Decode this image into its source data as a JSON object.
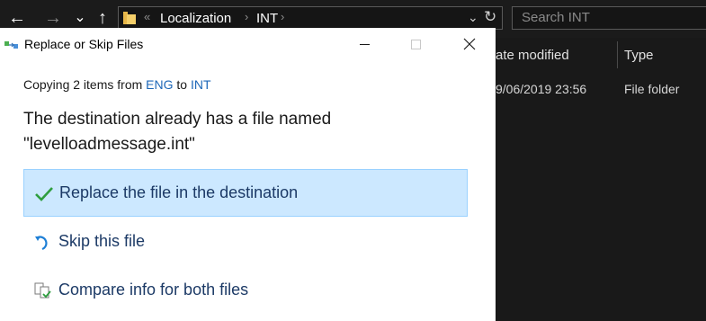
{
  "explorer": {
    "nav": {
      "back": "←",
      "forward": "→",
      "recent": "⌄",
      "up": "↑"
    },
    "address": {
      "overflow": "«",
      "crumbs": [
        "Localization",
        "INT"
      ],
      "separator": "›",
      "dropdown": "⌄",
      "refresh": "↻"
    },
    "search_placeholder": "Search INT",
    "columns": [
      "ate modified",
      "Type"
    ],
    "rows": [
      {
        "date": "9/06/2019 23:56",
        "type": "File folder"
      }
    ]
  },
  "dialog": {
    "title": "Replace or Skip Files",
    "copy_prefix": "Copying 2 items from ",
    "source": "ENG",
    "copy_mid": " to ",
    "destination": "INT",
    "message_line1": "The destination already has a file named",
    "message_line2": "\"levelloadmessage.int\"",
    "options": [
      {
        "label": "Replace the file in the destination",
        "icon": "checkmark-icon",
        "selected": true
      },
      {
        "label": "Skip this file",
        "icon": "skip-arrow-icon",
        "selected": false
      },
      {
        "label": "Compare info for both files",
        "icon": "compare-files-icon",
        "selected": false
      }
    ]
  },
  "colors": {
    "accent_link": "#1d67b8",
    "selection_fill": "#cce8ff",
    "selection_border": "#99d1ff",
    "check_green": "#2e9e3f",
    "skip_blue": "#1e7fd6",
    "explorer_bg": "#191919"
  }
}
